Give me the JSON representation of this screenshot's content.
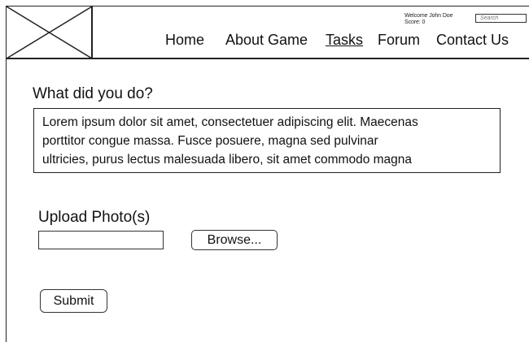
{
  "header": {
    "logo_icon": "image-placeholder-icon",
    "welcome_text": "Welcome John Doe",
    "score_text": "Score: 0",
    "search_placeholder": "Search",
    "nav": {
      "home": "Home",
      "about": "About Game",
      "tasks": "Tasks",
      "forum": "Forum",
      "contact": "Contact Us"
    },
    "active_nav": "Tasks"
  },
  "main": {
    "question_heading": "What did you do?",
    "answer_lines": [
      "Lorem ipsum dolor sit amet, consectetuer adipiscing elit. Maecenas",
      "porttitor congue massa. Fusce posuere, magna sed pulvinar",
      "ultricies, purus lectus malesuada libero, sit amet commodo magna"
    ],
    "upload_label": "Upload Photo(s)",
    "file_value": "",
    "browse_label": "Browse...",
    "submit_label": "Submit"
  }
}
